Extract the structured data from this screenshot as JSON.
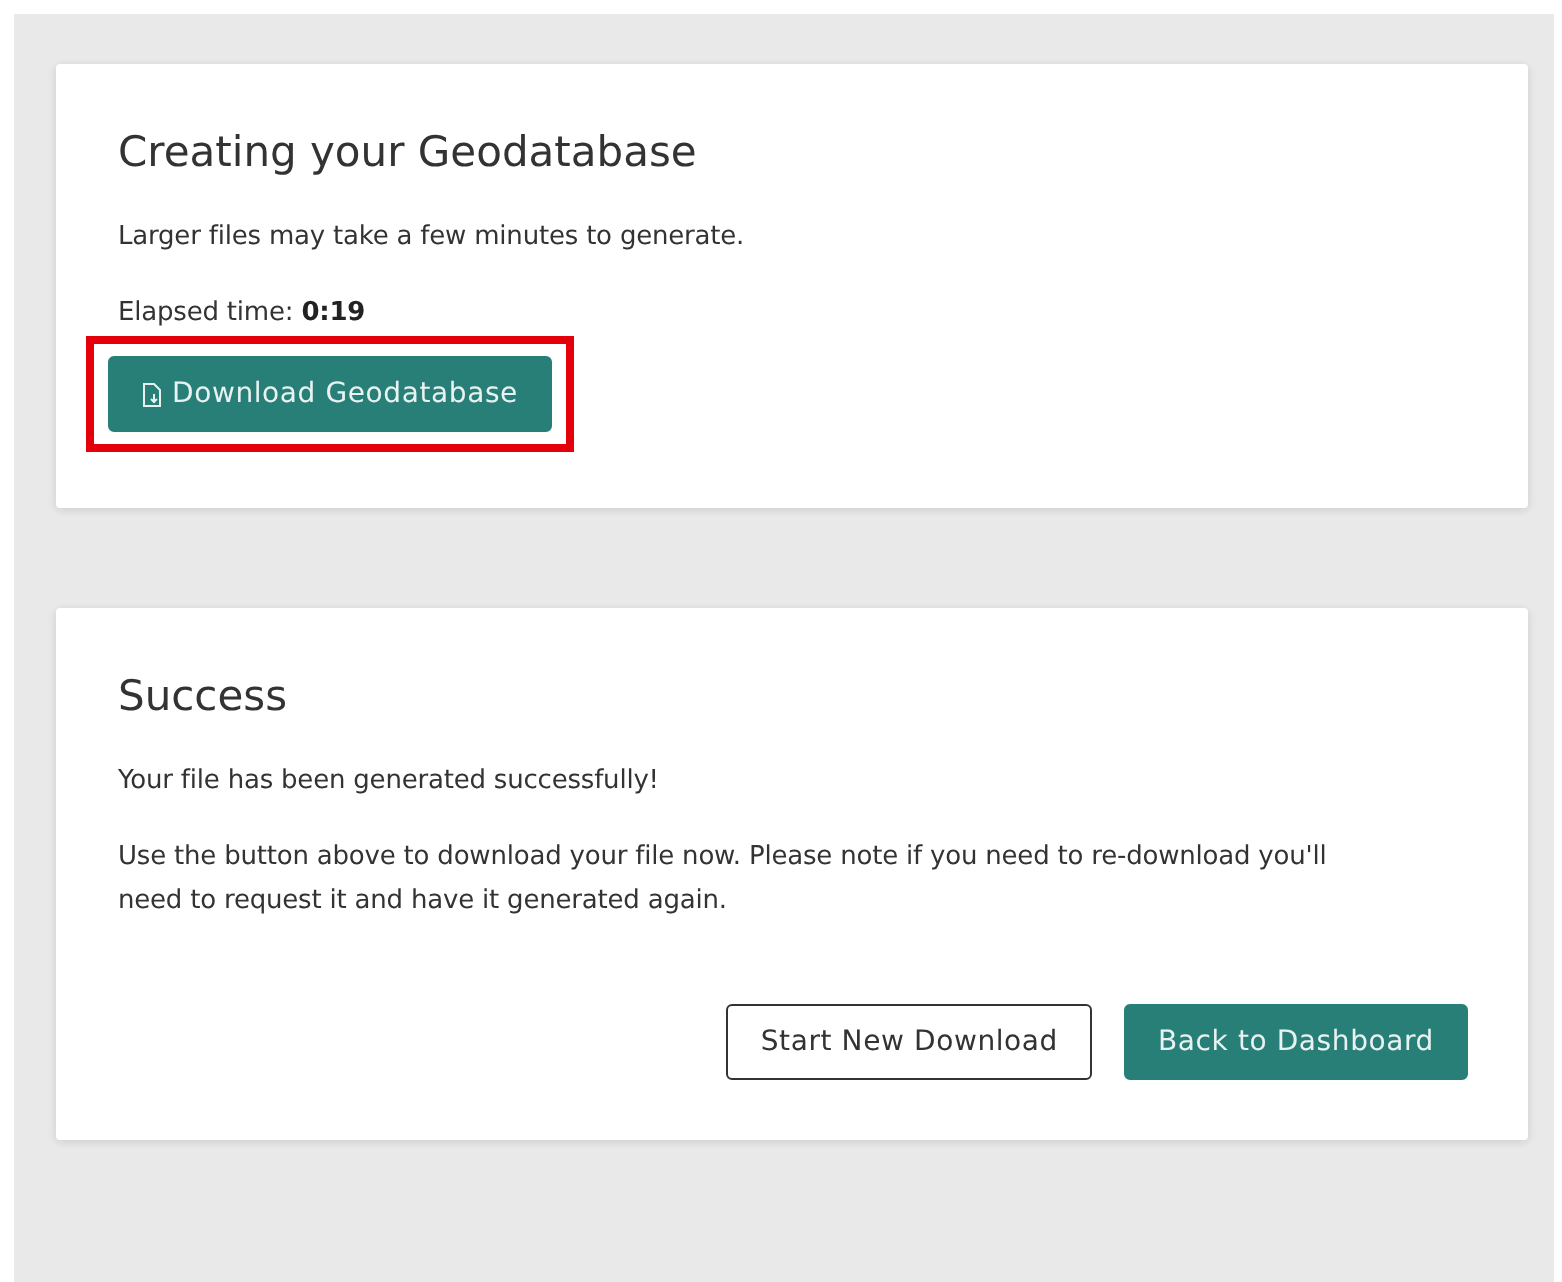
{
  "cards": [
    {
      "title": "Creating your Geodatabase",
      "paragraphs": [
        "Larger files may take a few minutes to generate.",
        "Elapsed time: **0:19**"
      ],
      "buttons": [
        {
          "label": "Download Geodatabase",
          "kind": "download",
          "highlighted": true
        }
      ]
    },
    {
      "title": "Success",
      "paragraphs": [
        "Your file has been generated successfully!",
        "Use the button above to download your file now. Please note if you need to re-download you'll need to request it and have it generated again."
      ],
      "buttons": [
        {
          "label": "Start New Download",
          "kind": "outline",
          "highlighted": false
        },
        {
          "label": "Back to Dashboard",
          "kind": "primary",
          "highlighted": false
        }
      ]
    }
  ]
}
